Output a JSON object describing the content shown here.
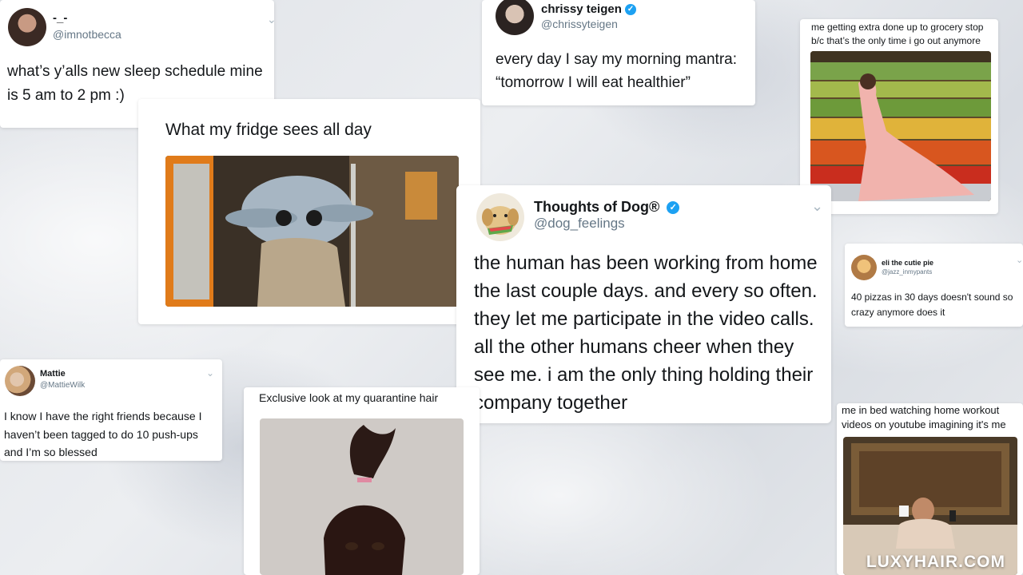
{
  "tweets": {
    "becca": {
      "display_name": "-_-",
      "handle": "@imnotbecca",
      "text": "what’s y’alls new sleep schedule mine is 5 am to 2 pm :)"
    },
    "chrissy": {
      "display_name": "chrissy teigen",
      "handle": "@chrissyteigen",
      "text": "every day I say my morning mantra: “tomorrow I will eat healthier”"
    },
    "grocery": {
      "caption": "me getting extra done up to grocery stop b/c that’s the only time i go out anymore"
    },
    "fridge": {
      "caption": "What my fridge sees all day"
    },
    "dog": {
      "display_name": "Thoughts of Dog®",
      "handle": "@dog_feelings",
      "text": "the human has been working from home the last couple days. and every so often. they let me participate in the video calls. all the other humans cheer when they see me. i am the only thing holding their company together"
    },
    "eli": {
      "display_name": "eli the cutie pie",
      "handle": "@jazz_inmypants",
      "text": "40 pizzas in 30 days doesn't sound so crazy anymore does it"
    },
    "mattie": {
      "display_name": "Mattie",
      "handle": "@MattieWilk",
      "text": "I know I have the right friends because I haven’t been tagged to do 10 push-ups and I’m so blessed"
    },
    "hair": {
      "caption": "Exclusive look at my quarantine hair"
    },
    "workout": {
      "caption": "me in bed watching home workout videos on youtube imagining it's me"
    }
  },
  "watermark": "LUXYHAIR.COM",
  "icons": {
    "verified": "verified-badge-icon",
    "chevron": "chevron-down-icon"
  },
  "colors": {
    "verified_blue": "#1da1f2",
    "handle_gray": "#657786",
    "text_dark": "#14171a"
  }
}
